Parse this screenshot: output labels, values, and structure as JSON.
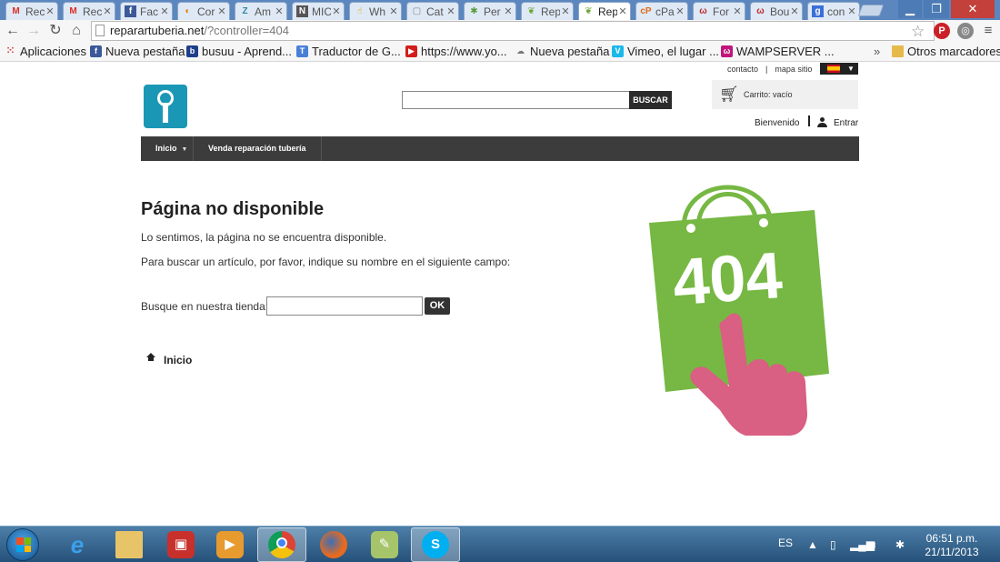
{
  "browser": {
    "tabs": [
      {
        "icon": "gmail-icon",
        "label": "Rec",
        "active": false
      },
      {
        "icon": "gmail-icon",
        "label": "Rec",
        "active": false
      },
      {
        "icon": "facebook-icon",
        "label": "Fac",
        "active": false
      },
      {
        "icon": "page-icon",
        "label": "Cor",
        "active": false
      },
      {
        "icon": "z-icon",
        "label": "Am",
        "active": false
      },
      {
        "icon": "n-icon",
        "label": "MIC",
        "active": false
      },
      {
        "icon": "hand-icon",
        "label": "Wh",
        "active": false
      },
      {
        "icon": "page-icon",
        "label": "Cat",
        "active": false
      },
      {
        "icon": "puzzle-icon",
        "label": "Per",
        "active": false
      },
      {
        "icon": "prestashop-icon",
        "label": "Rep",
        "active": false
      },
      {
        "icon": "prestashop-icon",
        "label": "Rep",
        "active": true
      },
      {
        "icon": "cpanel-icon",
        "label": "cPa",
        "active": false
      },
      {
        "icon": "wamp-icon",
        "label": "For",
        "active": false
      },
      {
        "icon": "wamp-icon",
        "label": "Bou",
        "active": false
      },
      {
        "icon": "google-icon",
        "label": "con",
        "active": false
      }
    ],
    "url": {
      "host": "reparartuberia.net",
      "path": "/?controller=404"
    },
    "bookmarks": [
      {
        "icon": "apps-icon",
        "label": "Aplicaciones"
      },
      {
        "icon": "facebook-icon",
        "label": "Nueva pestaña"
      },
      {
        "icon": "busuu-icon",
        "label": "busuu - Aprend..."
      },
      {
        "icon": "translate-icon",
        "label": "Traductor de G..."
      },
      {
        "icon": "youtube-icon",
        "label": "https://www.yo..."
      },
      {
        "icon": "page-icon",
        "label": "Nueva pestaña"
      },
      {
        "icon": "vimeo-icon",
        "label": "Vimeo, el lugar ..."
      },
      {
        "icon": "wamp-icon",
        "label": "WAMPSERVER ..."
      }
    ],
    "overflow": "»",
    "other_bookmarks": "Otros marcadores"
  },
  "shop": {
    "top_links": {
      "contact": "contacto",
      "separator": "|",
      "sitemap": "mapa sitio"
    },
    "search_button": "BUSCAR",
    "cart": "Carrito: vacío",
    "welcome": "Bienvenido",
    "login": "Entrar",
    "nav": {
      "home": "Inicio",
      "sell": "Venda reparación tubería"
    }
  },
  "content": {
    "title": "Página no disponible",
    "message1": "Lo sentimos, la página no se encuentra disponible.",
    "message2": "Para buscar un artículo, por favor, indique su nombre en el siguiente campo:",
    "search_label": "Busque en nuestra tienda:",
    "ok_button": "OK",
    "home_link": "Inicio",
    "illustration_text": "404"
  },
  "taskbar": {
    "apps": [
      "windows-explorer-icon",
      "internet-explorer-icon",
      "folder-icon",
      "toolbox-icon",
      "media-player-icon",
      "chrome-icon",
      "firefox-icon",
      "notepad-icon",
      "skype-icon"
    ],
    "language": "ES",
    "time": "06:51 p.m.",
    "date": "21/11/2013"
  },
  "colors": {
    "tab_strip": "#5b86be",
    "nav_bar": "#3c3c3c",
    "bag_green": "#76b843",
    "hand_pink": "#d95f83",
    "logo_blue": "#1a97b5"
  }
}
